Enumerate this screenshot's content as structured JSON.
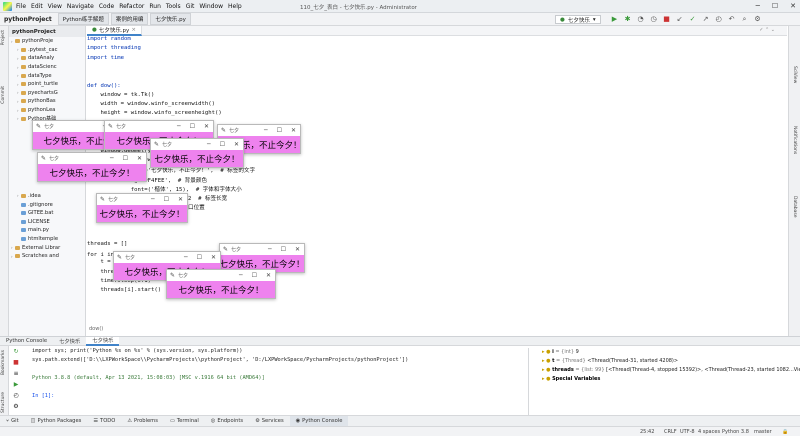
{
  "title_bar": {
    "menu": [
      "File",
      "Edit",
      "View",
      "Navigate",
      "Code",
      "Refactor",
      "Run",
      "Tools",
      "Git",
      "Window",
      "Help"
    ],
    "title": "110_七夕_表白 - 七夕快乐.py - Administrator"
  },
  "nav": {
    "project": "pythonProject",
    "tab1": "Python练手解题",
    "tab2": "案例的用编",
    "file": "七夕快乐.py",
    "run_config": "七夕快乐"
  },
  "editor": {
    "tab_label": "七夕快乐.py",
    "lines": [
      [
        "kw",
        "import random"
      ],
      [
        "kw",
        "import threading"
      ],
      [
        "kw",
        "import time"
      ],
      [
        "",
        ""
      ],
      [
        "",
        ""
      ],
      [
        "kw",
        "def dow():"
      ],
      [
        "",
        "    window = tk.Tk()"
      ],
      [
        "",
        "    width = window.winfo_screenwidth()"
      ],
      [
        "",
        "    height = window.winfo_screenheight()"
      ],
      [
        "",
        "    a = random.randrange(0, width)"
      ],
      [
        "",
        "    b = random.randrange(0, height)"
      ],
      [
        "",
        "    window.title('七夕')"
      ],
      [
        "",
        "    window.geometry(\"200x50\" + \"+\" + str(a) + \"+\" + str(b))"
      ],
      [
        "",
        "    tk.Label(window,"
      ],
      [
        "",
        "             text='七夕快乐，不止今夕！',  # 标签的文字"
      ],
      [
        "",
        "             bg='#F4FEE',  # 背景颜色"
      ],
      [
        "",
        "             font=('楷体', 15),  # 字体和字体大小"
      ],
      [
        "",
        "             width=15, height=2  # 标签长宽"
      ],
      [
        "",
        "             ).pack()  # 固定窗口位置"
      ],
      [
        "",
        "    window.mainloop()"
      ],
      [
        "",
        ""
      ],
      [
        "",
        ""
      ],
      [
        "",
        "threads = []"
      ],
      [
        "",
        "for i in range(100):  # 需要的弹框数量"
      ],
      [
        "",
        "    t = threading.Thread(target=dow)"
      ],
      [
        "",
        "    threads.append(t)"
      ],
      [
        "",
        "    time.sleep(0.1)"
      ],
      [
        "",
        "    threads[i].start()"
      ]
    ],
    "bottom_crumb": "dow()"
  },
  "project_tree": [
    "pythonProje",
    ".pytest_cac",
    "dataAnaly",
    "dataScienc",
    "dataType",
    "point_turtle",
    "pyechartsG",
    "pythonBas",
    "pythonLea",
    "Python基础",
    "",
    "",
    "",
    "",
    "",
    "",
    "",
    "",
    ".idea",
    ".gitignore",
    "GITEE.bat",
    "LICENSE",
    "main.py",
    "htmltemple",
    "External Librar",
    "Scratches and"
  ],
  "popup": {
    "title": "七夕",
    "text": "七夕快乐，不止今夕！"
  },
  "console": {
    "tabs": [
      "Python Console",
      "七夕快乐",
      "七夕快乐"
    ],
    "lines": [
      "import sys; print('Python %s on %s' % (sys.version, sys.platform))",
      "sys.path.extend(['D:\\\\LXPWorkSpace\\\\PycharmProjects\\\\pythonProject', 'D:/LXPWorkSpace/PycharmProjects/pythonProject'])",
      "",
      "Python 3.8.8 (default, Apr 13 2021, 15:08:03) [MSC v.1916 64 bit (AMD64)]",
      "",
      "In [1]:"
    ],
    "vars": [
      {
        "name": "i",
        "type": "= {int}",
        "value": "9"
      },
      {
        "name": "t",
        "type": "= {Thread}",
        "value": "<Thread(Thread-31, started 4208)>"
      },
      {
        "name": "threads",
        "type": "= {list: 99}",
        "value": "[<Thread(Thread-4, stopped 15392)>, <Thread(Thread-23, started 1082...View"
      },
      {
        "name": "Special Variables",
        "type": "",
        "value": ""
      }
    ]
  },
  "bottom_tabs": [
    "Git",
    "Python Packages",
    "TODO",
    "Problems",
    "Terminal",
    "Endpoints",
    "Services",
    "Python Console"
  ],
  "status": {
    "pos": "25:42",
    "crlf": "CRLF",
    "enc": "UTF-8",
    "indent": "4 spaces",
    "interp": "Python 3.8",
    "branch": "master"
  }
}
